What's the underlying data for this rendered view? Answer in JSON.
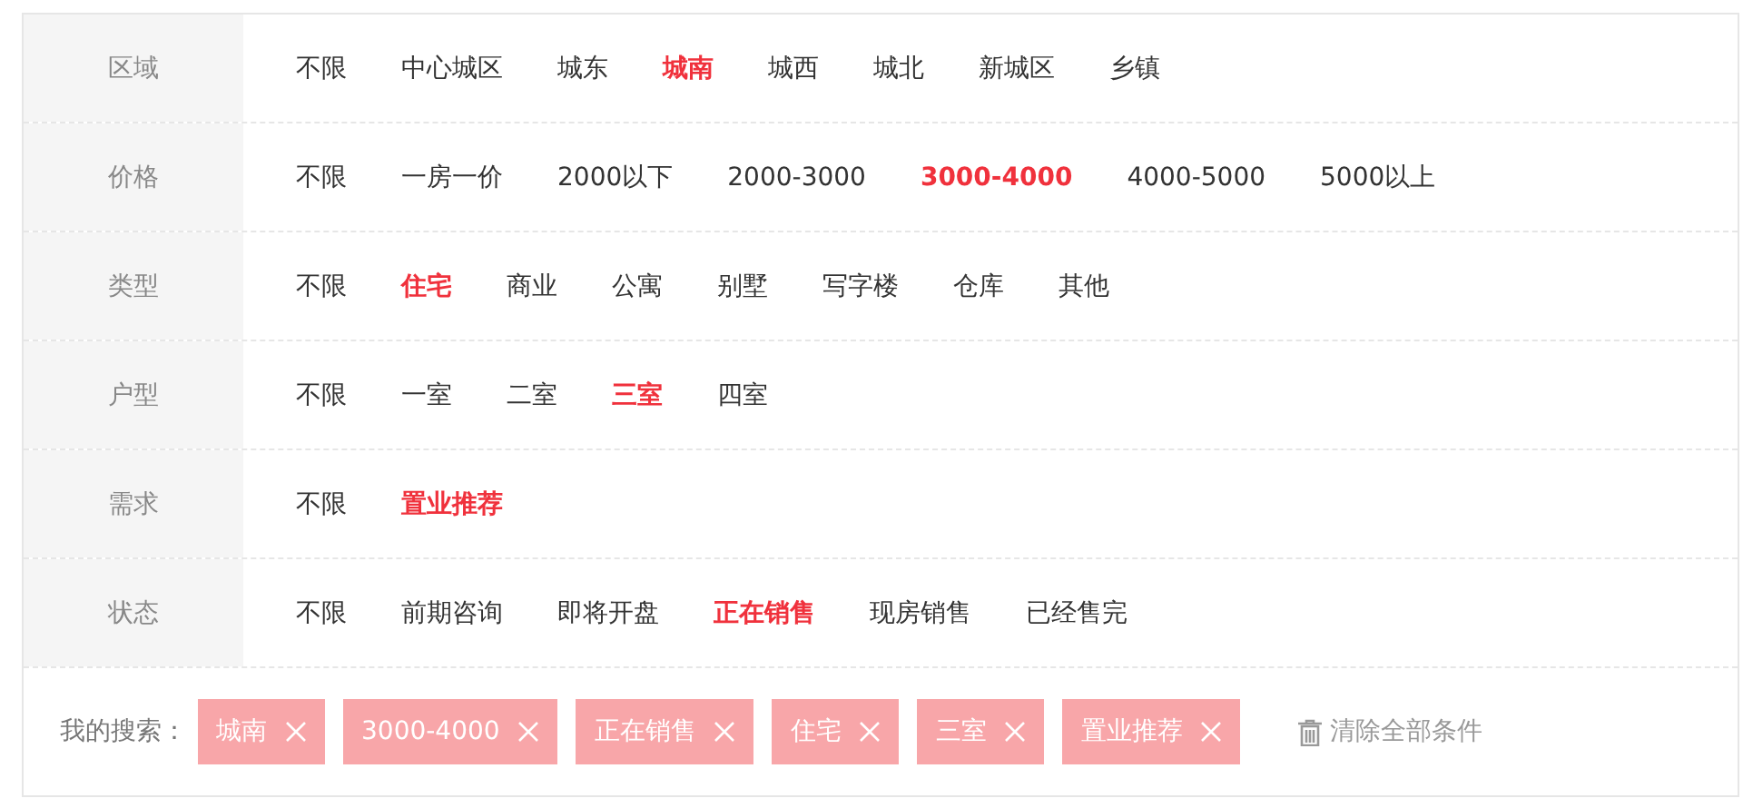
{
  "filters": [
    {
      "label": "区域",
      "options": [
        {
          "text": "不限",
          "selected": false
        },
        {
          "text": "中心城区",
          "selected": false
        },
        {
          "text": "城东",
          "selected": false
        },
        {
          "text": "城南",
          "selected": true
        },
        {
          "text": "城西",
          "selected": false
        },
        {
          "text": "城北",
          "selected": false
        },
        {
          "text": "新城区",
          "selected": false
        },
        {
          "text": "乡镇",
          "selected": false
        }
      ]
    },
    {
      "label": "价格",
      "options": [
        {
          "text": "不限",
          "selected": false
        },
        {
          "text": "一房一价",
          "selected": false
        },
        {
          "text": "2000以下",
          "selected": false
        },
        {
          "text": "2000-3000",
          "selected": false
        },
        {
          "text": "3000-4000",
          "selected": true
        },
        {
          "text": "4000-5000",
          "selected": false
        },
        {
          "text": "5000以上",
          "selected": false
        }
      ]
    },
    {
      "label": "类型",
      "options": [
        {
          "text": "不限",
          "selected": false
        },
        {
          "text": "住宅",
          "selected": true
        },
        {
          "text": "商业",
          "selected": false
        },
        {
          "text": "公寓",
          "selected": false
        },
        {
          "text": "别墅",
          "selected": false
        },
        {
          "text": "写字楼",
          "selected": false
        },
        {
          "text": "仓库",
          "selected": false
        },
        {
          "text": "其他",
          "selected": false
        }
      ]
    },
    {
      "label": "户型",
      "options": [
        {
          "text": "不限",
          "selected": false
        },
        {
          "text": "一室",
          "selected": false
        },
        {
          "text": "二室",
          "selected": false
        },
        {
          "text": "三室",
          "selected": true
        },
        {
          "text": "四室",
          "selected": false
        }
      ]
    },
    {
      "label": "需求",
      "options": [
        {
          "text": "不限",
          "selected": false
        },
        {
          "text": "置业推荐",
          "selected": true
        }
      ]
    },
    {
      "label": "状态",
      "options": [
        {
          "text": "不限",
          "selected": false
        },
        {
          "text": "前期咨询",
          "selected": false
        },
        {
          "text": "即将开盘",
          "selected": false
        },
        {
          "text": "正在销售",
          "selected": true
        },
        {
          "text": "现房销售",
          "selected": false
        },
        {
          "text": "已经售完",
          "selected": false
        }
      ]
    }
  ],
  "my_search": {
    "label": "我的搜索：",
    "tags": [
      "城南",
      "3000-4000",
      "正在销售",
      "住宅",
      "三室",
      "置业推荐"
    ],
    "clear_button": "清除全部条件"
  }
}
